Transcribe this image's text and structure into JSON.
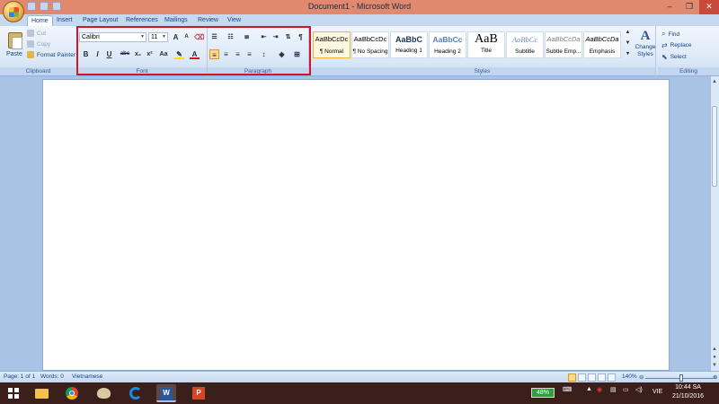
{
  "window": {
    "title": "Document1 - Microsoft Word",
    "controls": [
      "–",
      "❐",
      "✕"
    ]
  },
  "tabs": [
    {
      "label": "Home",
      "active": true
    },
    {
      "label": "Insert"
    },
    {
      "label": "Page Layout"
    },
    {
      "label": "References"
    },
    {
      "label": "Mailings"
    },
    {
      "label": "Review"
    },
    {
      "label": "View"
    }
  ],
  "ribbon": {
    "clipboard": {
      "paste_label": "Paste",
      "cut_label": "Cut",
      "copy_label": "Copy",
      "format_painter_label": "Format Painter",
      "group_label": "Clipboard"
    },
    "font": {
      "font_name": "Calibri",
      "font_size": "11",
      "group_label": "Font",
      "buttons": [
        "B",
        "I",
        "U",
        "abc",
        "x₂",
        "x²",
        "Aa",
        "A"
      ]
    },
    "paragraph": {
      "group_label": "Paragraph"
    },
    "styles": {
      "group_label": "Styles",
      "items": [
        {
          "sample": "AaBbCcDc",
          "name": "¶ Normal",
          "active": true
        },
        {
          "sample": "AaBbCcDc",
          "name": "¶ No Spacing"
        },
        {
          "sample": "AaBbC",
          "name": "Heading 1"
        },
        {
          "sample": "AaBbCc",
          "name": "Heading 2"
        },
        {
          "sample": "AaB",
          "name": "Title"
        },
        {
          "sample": "AaBbCc",
          "name": "Subtitle"
        },
        {
          "sample": "AaBbCcDa",
          "name": "Subtle Emp..."
        },
        {
          "sample": "AaBbCcDa",
          "name": "Emphasis"
        }
      ],
      "change_styles_label": "Change Styles"
    },
    "editing": {
      "group_label": "Editing",
      "find_label": "Find",
      "replace_label": "Replace",
      "select_label": "Select"
    }
  },
  "statusbar": {
    "page": "Page: 1 of 1",
    "words": "Words: 0",
    "language": "Vietnamese",
    "zoom": "140%"
  },
  "taskbar": {
    "battery": "48%",
    "language": "VIE",
    "time": "10:44 SA",
    "date": "21/10/2016"
  },
  "colors": {
    "titlebar": "#e0896f",
    "highlight_box": "#d4142b",
    "ribbon_text": "#15428b"
  }
}
